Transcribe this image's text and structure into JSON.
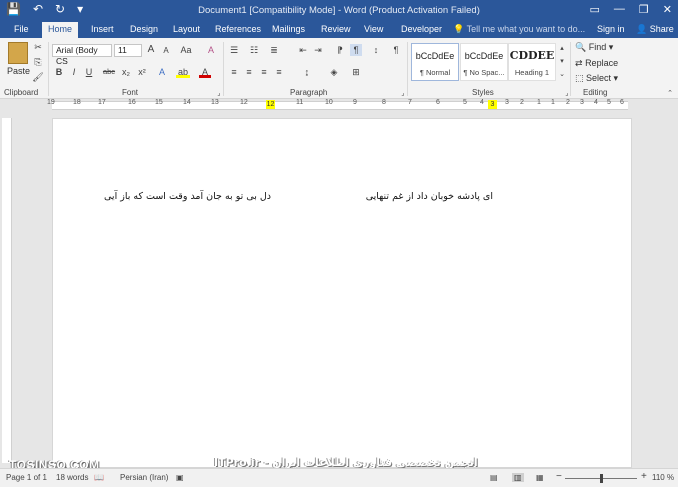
{
  "window": {
    "title": "Document1 [Compatibility Mode] - Word (Product Activation Failed)",
    "minimize_glyph": "—",
    "restore_glyph": "❐",
    "close_glyph": "✕",
    "ribbon_display_glyph": "▭"
  },
  "qat": {
    "save_glyph": "💾",
    "undo_glyph": "↶",
    "redo_glyph": "↻",
    "more_glyph": "▾"
  },
  "tabs": [
    "File",
    "Home",
    "Insert",
    "Design",
    "Layout",
    "References",
    "Mailings",
    "Review",
    "View",
    "Developer"
  ],
  "tell_me": "Tell me what you want to do...",
  "account": {
    "signin": "Sign in",
    "share": "Share"
  },
  "ribbon": {
    "clipboard": {
      "label": "Clipboard",
      "paste": "Paste"
    },
    "font": {
      "label": "Font",
      "name": "Arial (Body CS",
      "size": "11",
      "grow": "A",
      "shrink": "A",
      "case": "Aa",
      "bold": "B",
      "italic": "I",
      "underline": "U",
      "strike": "abc",
      "sub": "x₂",
      "sup": "x²",
      "effects": "A",
      "highlight": "ab",
      "color": "A"
    },
    "paragraph": {
      "label": "Paragraph",
      "pilcrow": "¶"
    },
    "styles": {
      "label": "Styles",
      "items": [
        {
          "preview": "bCcDdEe",
          "name": "¶ Normal"
        },
        {
          "preview": "bCcDdEe",
          "name": "¶ No Spac..."
        },
        {
          "preview": "CDDEE",
          "name": "Heading 1"
        }
      ]
    },
    "editing": {
      "label": "Editing",
      "find": "Find",
      "replace": "Replace",
      "select": "Select"
    }
  },
  "ruler": {
    "ticks": [
      "19",
      "18",
      "17",
      "16",
      "15",
      "14",
      "13",
      "12",
      "11",
      "10",
      "9",
      "8",
      "7",
      "6",
      "5",
      "4",
      "3",
      "2",
      "1",
      "1",
      "2",
      "3",
      "4",
      "5",
      "6",
      "7"
    ],
    "markers": [
      "12",
      "3"
    ]
  },
  "document": {
    "lines": [
      "ای پادشه خوبان داد از غم تنهایی",
      "دل بی تو به جان آمد وقت است که باز آیی"
    ]
  },
  "watermarks": {
    "left": "TOSINSO.COM",
    "center": "ITPro.ir - انجمن تخصصی فناوری اطلاعات ایران"
  },
  "status": {
    "page": "Page 1 of 1",
    "words": "18 words",
    "language": "Persian (Iran)",
    "zoom": "110 %",
    "zoom_out": "−",
    "zoom_in": "+"
  }
}
